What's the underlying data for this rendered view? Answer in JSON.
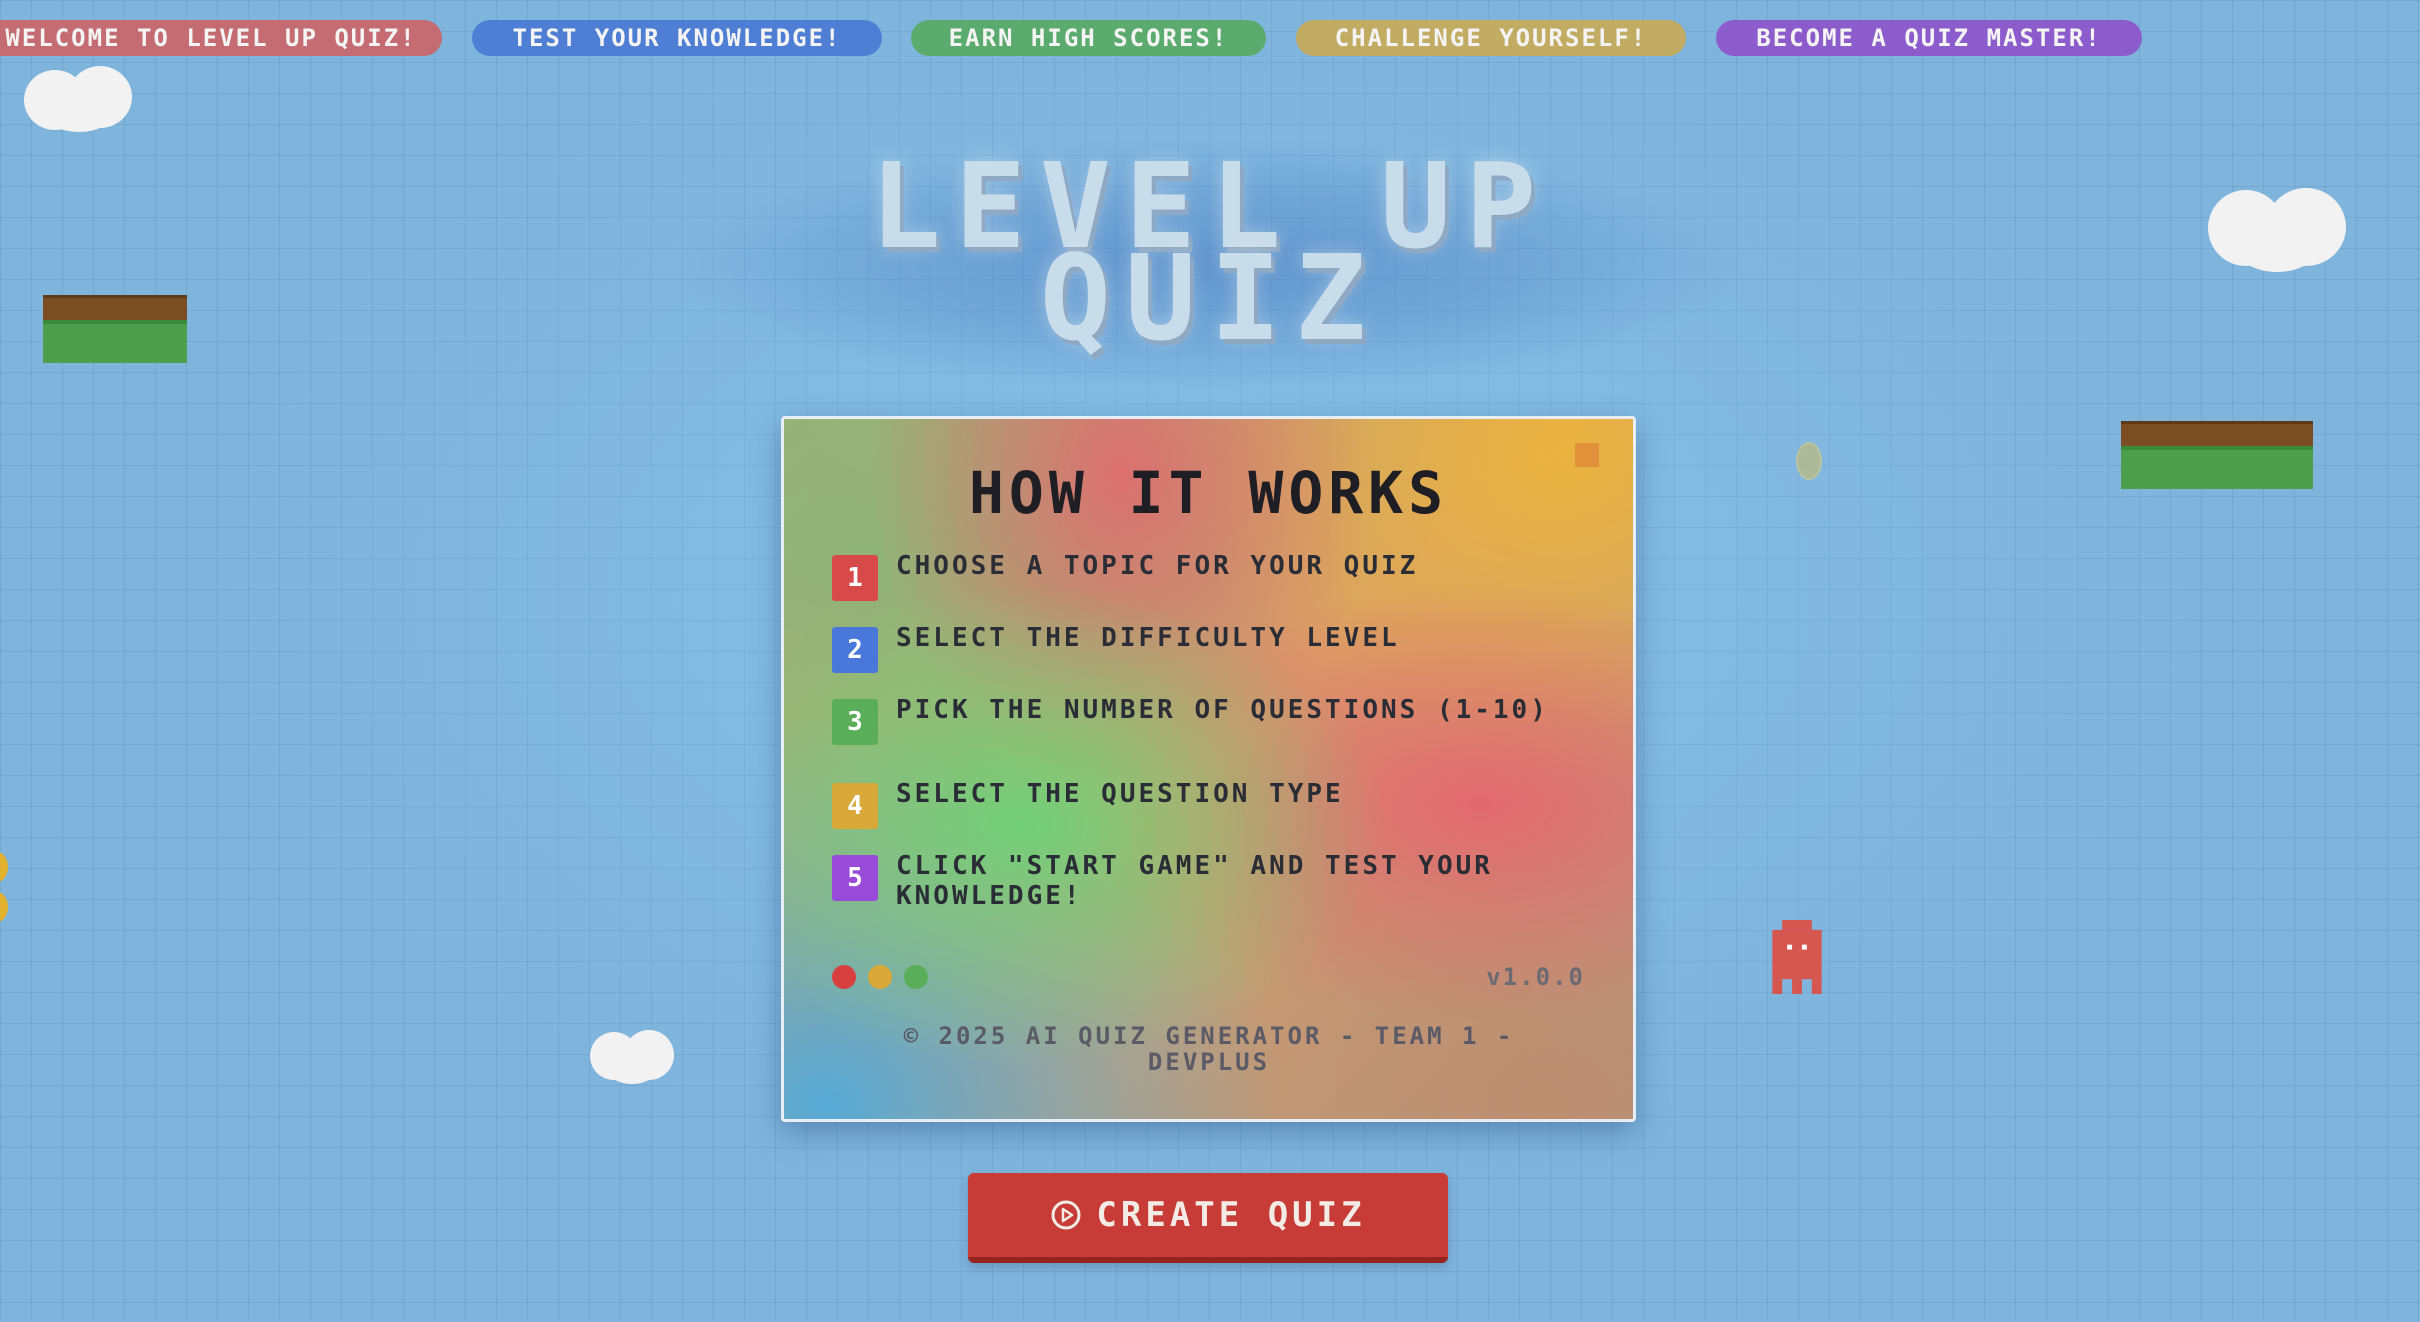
{
  "ticker": {
    "items": [
      {
        "label": "WELCOME TO LEVEL UP QUIZ!",
        "color": "#c86a6e"
      },
      {
        "label": "TEST YOUR KNOWLEDGE!",
        "color": "#4a7fd6"
      },
      {
        "label": "EARN HIGH SCORES!",
        "color": "#5aae6e"
      },
      {
        "label": "CHALLENGE YOURSELF!",
        "color": "#c4aa5e"
      },
      {
        "label": "BECOME A QUIZ MASTER!",
        "color": "#8a5ad0"
      }
    ]
  },
  "title": {
    "line1": "LEVEL UP",
    "line2": "QUIZ"
  },
  "card": {
    "heading": "HOW IT WORKS",
    "steps": [
      {
        "num": "1",
        "text": "CHOOSE A TOPIC FOR YOUR QUIZ",
        "color": "#d84a4a"
      },
      {
        "num": "2",
        "text": "SELECT THE DIFFICULTY LEVEL",
        "color": "#4a78da"
      },
      {
        "num": "3",
        "text": "PICK THE NUMBER OF QUESTIONS (1-10)",
        "color": "#5aae5a"
      },
      {
        "num": "4",
        "text": "SELECT THE QUESTION TYPE",
        "color": "#d8a838"
      },
      {
        "num": "5",
        "text": "CLICK \"START GAME\" AND TEST YOUR KNOWLEDGE!",
        "color": "#9a4ad8"
      }
    ],
    "window_dots": [
      "#d84040",
      "#d8a838",
      "#5aae5a"
    ],
    "version": "v1.0.0",
    "copyright": "© 2025 AI QUIZ GENERATOR - TEAM 1 - DEVPLUS"
  },
  "create_button": {
    "label": "CREATE QUIZ",
    "icon": "play-circle-icon"
  }
}
